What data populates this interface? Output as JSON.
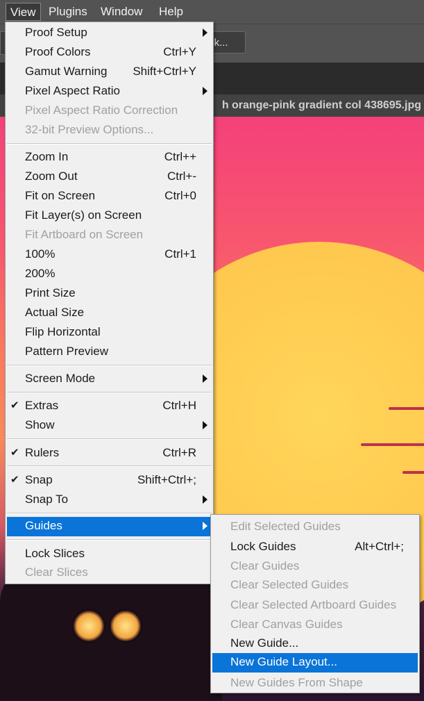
{
  "menubar": {
    "items": [
      {
        "label": "View"
      },
      {
        "label": "Plugins"
      },
      {
        "label": "Window"
      },
      {
        "label": "Help"
      }
    ]
  },
  "toolbar": {
    "button_label": "sk..."
  },
  "document": {
    "tab_title": "h orange-pink gradient col 438695.jpg"
  },
  "view_menu": {
    "items": [
      {
        "label": "Proof Setup",
        "shortcut": ""
      },
      {
        "label": "Proof Colors",
        "shortcut": "Ctrl+Y"
      },
      {
        "label": "Gamut Warning",
        "shortcut": "Shift+Ctrl+Y"
      },
      {
        "label": "Pixel Aspect Ratio",
        "shortcut": ""
      },
      {
        "label": "Pixel Aspect Ratio Correction",
        "shortcut": ""
      },
      {
        "label": "32-bit Preview Options...",
        "shortcut": ""
      },
      {
        "label": "Zoom In",
        "shortcut": "Ctrl++"
      },
      {
        "label": "Zoom Out",
        "shortcut": "Ctrl+-"
      },
      {
        "label": "Fit on Screen",
        "shortcut": "Ctrl+0"
      },
      {
        "label": "Fit Layer(s) on Screen",
        "shortcut": ""
      },
      {
        "label": "Fit Artboard on Screen",
        "shortcut": ""
      },
      {
        "label": "100%",
        "shortcut": "Ctrl+1"
      },
      {
        "label": "200%",
        "shortcut": ""
      },
      {
        "label": "Print Size",
        "shortcut": ""
      },
      {
        "label": "Actual Size",
        "shortcut": ""
      },
      {
        "label": "Flip Horizontal",
        "shortcut": ""
      },
      {
        "label": "Pattern Preview",
        "shortcut": ""
      },
      {
        "label": "Screen Mode",
        "shortcut": ""
      },
      {
        "label": "Extras",
        "shortcut": "Ctrl+H"
      },
      {
        "label": "Show",
        "shortcut": ""
      },
      {
        "label": "Rulers",
        "shortcut": "Ctrl+R"
      },
      {
        "label": "Snap",
        "shortcut": "Shift+Ctrl+;"
      },
      {
        "label": "Snap To",
        "shortcut": ""
      },
      {
        "label": "Guides",
        "shortcut": ""
      },
      {
        "label": "Lock Slices",
        "shortcut": ""
      },
      {
        "label": "Clear Slices",
        "shortcut": ""
      }
    ]
  },
  "guides_submenu": {
    "items": [
      {
        "label": "Edit Selected Guides",
        "shortcut": ""
      },
      {
        "label": "Lock Guides",
        "shortcut": "Alt+Ctrl+;"
      },
      {
        "label": "Clear Guides",
        "shortcut": ""
      },
      {
        "label": "Clear Selected Guides",
        "shortcut": ""
      },
      {
        "label": "Clear Selected Artboard Guides",
        "shortcut": ""
      },
      {
        "label": "Clear Canvas Guides",
        "shortcut": ""
      },
      {
        "label": "New Guide...",
        "shortcut": ""
      },
      {
        "label": "New Guide Layout...",
        "shortcut": ""
      },
      {
        "label": "New Guides From Shape",
        "shortcut": ""
      }
    ]
  },
  "colors": {
    "highlight": "#0a74d8",
    "menu_bg": "#f0f0f0",
    "disabled_text": "#a0a0a0"
  }
}
